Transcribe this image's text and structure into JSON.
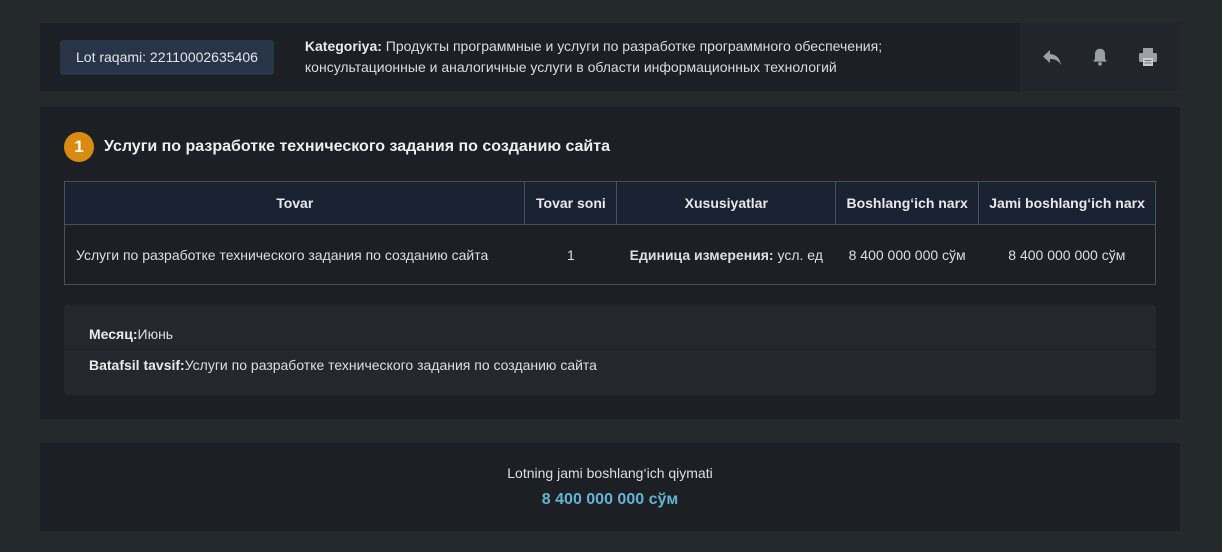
{
  "header": {
    "lot_label": "Lot raqami: 22110002635406",
    "category_label": "Kategoriya:",
    "category_text": " Продукты программные и услуги по разработке программного обеспечения; консультационные и аналогичные услуги в области информационных технологий",
    "actions": [
      {
        "icon": "reply-icon"
      },
      {
        "icon": "bell-icon"
      },
      {
        "icon": "printer-icon"
      }
    ]
  },
  "item": {
    "number": "1",
    "title": "Услуги по разработке технического задания по созданию сайта",
    "table": {
      "headers": [
        "Tovar",
        "Tovar soni",
        "Xususiyatlar",
        "Boshlang‘ich narx",
        "Jami boshlang‘ich narx"
      ],
      "row": {
        "tovar": "Услуги по разработке технического задания по созданию сайта",
        "soni": "1",
        "spec_label": "Единица измерения:",
        "spec_value": " усл. ед",
        "price": "8 400 000 000 сўм",
        "total": "8 400 000 000 сўм"
      }
    },
    "month_label": "Месяц:",
    "month_value": "Июнь",
    "desc_label": "Batafsil tavsif:",
    "desc_value": "Услуги по разработке технического задания по созданию сайта"
  },
  "total": {
    "label": "Lotning jami boshlang‘ich qiymati",
    "value": "8 400 000 000 сўм"
  },
  "colors": {
    "background": "#242a2b",
    "panel": "#1c1f24",
    "badge": "#d98a10",
    "price": "#f39a2a",
    "total": "#63b4d4"
  }
}
